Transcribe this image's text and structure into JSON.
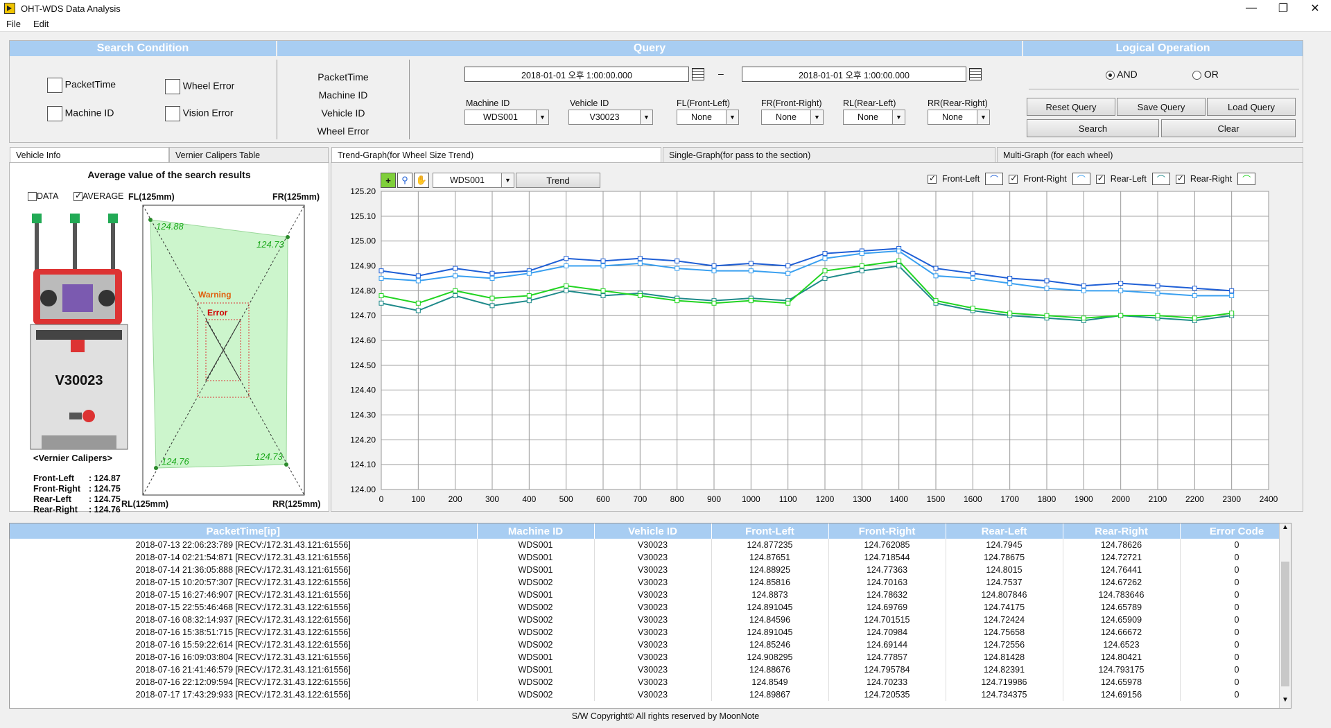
{
  "window": {
    "title": "OHT-WDS Data Analysis",
    "minimize": "—",
    "maximize": "❐",
    "close": "✕"
  },
  "menu": [
    "File",
    "Edit"
  ],
  "search_condition": {
    "header": "Search Condition",
    "options": [
      "PacketTime",
      "Machine ID",
      "Wheel Error",
      "Vision Error"
    ]
  },
  "query": {
    "header": "Query",
    "labels": [
      "PacketTime",
      "Machine ID",
      "Vehicle ID",
      "Wheel Error"
    ],
    "date_from": "2018-01-01  오후 1:00:00.000",
    "date_to": "2018-01-01  오후 1:00:00.000",
    "dash": "–",
    "fields": [
      {
        "label": "Machine ID",
        "value": "WDS001"
      },
      {
        "label": "Vehicle ID",
        "value": "V30023"
      },
      {
        "label": "FL(Front-Left)",
        "value": "None"
      },
      {
        "label": "FR(Front-Right)",
        "value": "None"
      },
      {
        "label": "RL(Rear-Left)",
        "value": "None"
      },
      {
        "label": "RR(Rear-Right)",
        "value": "None"
      }
    ]
  },
  "logical": {
    "header": "Logical Operation",
    "and_label": "AND",
    "or_label": "OR",
    "selected": "AND",
    "buttons": [
      "Reset Query",
      "Save Query",
      "Load Query",
      "Search",
      "Clear"
    ]
  },
  "left_tabs": [
    "Vehicle Info",
    "Vernier Calipers Table"
  ],
  "vehicle_info": {
    "title": "Average value of the search results",
    "data_label": "DATA",
    "average_label": "AVERAGE",
    "vehicle_id": "V30023",
    "caption": "<Vernier Calipers>",
    "readings": [
      {
        "name": "Front-Left",
        "value": ": 124.87"
      },
      {
        "name": "Front-Right",
        "value": ": 124.75"
      },
      {
        "name": "Rear-Left",
        "value": ": 124.75"
      },
      {
        "name": "Rear-Right",
        "value": ": 124.76"
      }
    ],
    "corners": {
      "fl": "FL(125mm)",
      "fr": "FR(125mm)",
      "rl": "RL(125mm)",
      "rr": "RR(125mm)"
    },
    "corner_values": {
      "fl": "124.88",
      "fr": "124.73",
      "rl": "124.76",
      "rr": "124.73"
    },
    "warning": "Warning",
    "error": "Error"
  },
  "graph_tabs": [
    "Trend-Graph(for Wheel Size Trend)",
    "Single-Graph(for pass to the section)",
    "Multi-Graph (for each wheel)"
  ],
  "graph_toolbar": {
    "machine": "WDS001",
    "trend_button": "Trend"
  },
  "legend": [
    "Front-Left",
    "Front-Right",
    "Rear-Left",
    "Rear-Right"
  ],
  "colors": {
    "front_left": "#1f5fd6",
    "front_right": "#3aa0f0",
    "rear_left": "#1e8a8a",
    "rear_right": "#22d422",
    "header": "#a8cdf2"
  },
  "chart_data": {
    "type": "line",
    "xlim": [
      0,
      2400
    ],
    "ylim": [
      124.0,
      125.2
    ],
    "xticks": [
      0,
      100,
      200,
      300,
      400,
      500,
      600,
      700,
      800,
      900,
      1000,
      1100,
      1200,
      1300,
      1400,
      1500,
      1600,
      1700,
      1800,
      1900,
      2000,
      2100,
      2200,
      2300,
      2400
    ],
    "yticks": [
      "124.00",
      "124.10",
      "124.20",
      "124.30",
      "124.40",
      "124.50",
      "124.60",
      "124.70",
      "124.80",
      "124.90",
      "125.00",
      "125.10",
      "125.20"
    ],
    "grid": true,
    "legend_position": "top-right",
    "series": [
      {
        "name": "Front-Left",
        "x": [
          0,
          100,
          200,
          300,
          400,
          500,
          600,
          700,
          800,
          900,
          1000,
          1100,
          1200,
          1300,
          1400,
          1500,
          1600,
          1700,
          1800,
          1900,
          2000,
          2100,
          2200,
          2300
        ],
        "values": [
          124.88,
          124.86,
          124.89,
          124.87,
          124.88,
          124.93,
          124.92,
          124.93,
          124.92,
          124.9,
          124.91,
          124.9,
          124.95,
          124.96,
          124.97,
          124.89,
          124.87,
          124.85,
          124.84,
          124.82,
          124.83,
          124.82,
          124.81,
          124.8
        ]
      },
      {
        "name": "Front-Right",
        "x": [
          0,
          100,
          200,
          300,
          400,
          500,
          600,
          700,
          800,
          900,
          1000,
          1100,
          1200,
          1300,
          1400,
          1500,
          1600,
          1700,
          1800,
          1900,
          2000,
          2100,
          2200,
          2300
        ],
        "values": [
          124.85,
          124.84,
          124.86,
          124.85,
          124.87,
          124.9,
          124.9,
          124.91,
          124.89,
          124.88,
          124.88,
          124.87,
          124.93,
          124.95,
          124.96,
          124.86,
          124.85,
          124.83,
          124.81,
          124.8,
          124.8,
          124.79,
          124.78,
          124.78
        ]
      },
      {
        "name": "Rear-Left",
        "x": [
          0,
          100,
          200,
          300,
          400,
          500,
          600,
          700,
          800,
          900,
          1000,
          1100,
          1200,
          1300,
          1400,
          1500,
          1600,
          1700,
          1800,
          1900,
          2000,
          2100,
          2200,
          2300
        ],
        "values": [
          124.75,
          124.72,
          124.78,
          124.74,
          124.76,
          124.8,
          124.78,
          124.79,
          124.77,
          124.76,
          124.77,
          124.76,
          124.85,
          124.88,
          124.9,
          124.75,
          124.72,
          124.7,
          124.69,
          124.68,
          124.7,
          124.69,
          124.68,
          124.7
        ]
      },
      {
        "name": "Rear-Right",
        "x": [
          0,
          100,
          200,
          300,
          400,
          500,
          600,
          700,
          800,
          900,
          1000,
          1100,
          1200,
          1300,
          1400,
          1500,
          1600,
          1700,
          1800,
          1900,
          2000,
          2100,
          2200,
          2300
        ],
        "values": [
          124.78,
          124.75,
          124.8,
          124.77,
          124.78,
          124.82,
          124.8,
          124.78,
          124.76,
          124.75,
          124.76,
          124.75,
          124.88,
          124.9,
          124.92,
          124.76,
          124.73,
          124.71,
          124.7,
          124.69,
          124.7,
          124.7,
          124.69,
          124.71
        ]
      }
    ]
  },
  "table": {
    "columns": [
      "PacketTime[ip]",
      "Machine ID",
      "Vehicle ID",
      "Front-Left",
      "Front-Right",
      "Rear-Left",
      "Rear-Right",
      "Error Code"
    ],
    "rows": [
      [
        "2018-07-13 22:06:23:789 [RECV:/172.31.43.121:61556]",
        "WDS001",
        "V30023",
        "124.877235",
        "124.762085",
        "124.7945",
        "124.78626",
        "0"
      ],
      [
        "2018-07-14 02:21:54:871 [RECV:/172.31.43.121:61556]",
        "WDS001",
        "V30023",
        "124.87651",
        "124.718544",
        "124.78675",
        "124.72721",
        "0"
      ],
      [
        "2018-07-14 21:36:05:888 [RECV:/172.31.43.121:61556]",
        "WDS001",
        "V30023",
        "124.88925",
        "124.77363",
        "124.8015",
        "124.76441",
        "0"
      ],
      [
        "2018-07-15 10:20:57:307 [RECV:/172.31.43.122:61556]",
        "WDS002",
        "V30023",
        "124.85816",
        "124.70163",
        "124.7537",
        "124.67262",
        "0"
      ],
      [
        "2018-07-15 16:27:46:907 [RECV:/172.31.43.121:61556]",
        "WDS001",
        "V30023",
        "124.8873",
        "124.78632",
        "124.807846",
        "124.783646",
        "0"
      ],
      [
        "2018-07-15 22:55:46:468 [RECV:/172.31.43.122:61556]",
        "WDS002",
        "V30023",
        "124.891045",
        "124.69769",
        "124.74175",
        "124.65789",
        "0"
      ],
      [
        "2018-07-16 08:32:14:937 [RECV:/172.31.43.122:61556]",
        "WDS002",
        "V30023",
        "124.84596",
        "124.701515",
        "124.72424",
        "124.65909",
        "0"
      ],
      [
        "2018-07-16 15:38:51:715 [RECV:/172.31.43.122:61556]",
        "WDS002",
        "V30023",
        "124.891045",
        "124.70984",
        "124.75658",
        "124.66672",
        "0"
      ],
      [
        "2018-07-16 15:59:22:614 [RECV:/172.31.43.122:61556]",
        "WDS002",
        "V30023",
        "124.85246",
        "124.69144",
        "124.72556",
        "124.6523",
        "0"
      ],
      [
        "2018-07-16 16:09:03:804 [RECV:/172.31.43.121:61556]",
        "WDS001",
        "V30023",
        "124.908295",
        "124.77857",
        "124.81428",
        "124.80421",
        "0"
      ],
      [
        "2018-07-16 21:41:46:579 [RECV:/172.31.43.121:61556]",
        "WDS001",
        "V30023",
        "124.88676",
        "124.795784",
        "124.82391",
        "124.793175",
        "0"
      ],
      [
        "2018-07-16 22:12:09:594 [RECV:/172.31.43.122:61556]",
        "WDS002",
        "V30023",
        "124.8549",
        "124.70233",
        "124.719986",
        "124.65978",
        "0"
      ],
      [
        "2018-07-17 17:43:29:933 [RECV:/172.31.43.122:61556]",
        "WDS002",
        "V30023",
        "124.89867",
        "124.720535",
        "124.734375",
        "124.69156",
        "0"
      ]
    ]
  },
  "footer": "S/W Copyright© All rights reserved by MoonNote"
}
